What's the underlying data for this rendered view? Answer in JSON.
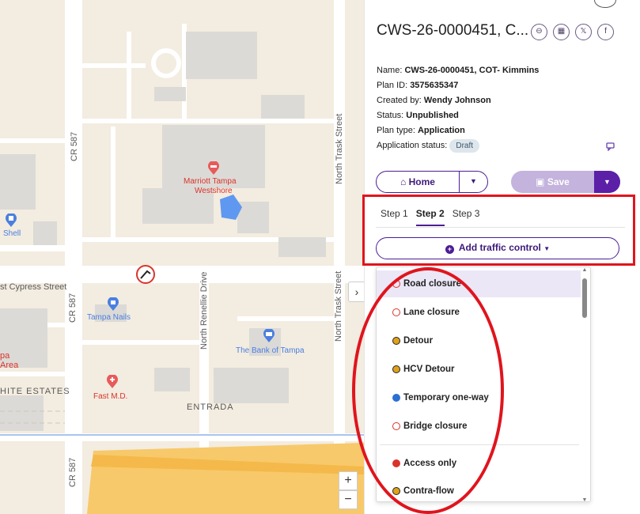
{
  "map": {
    "streets": {
      "cr587_upper": "CR 587",
      "cr587_mid": "CR 587",
      "cr587_lower": "CR 587",
      "north_trask_upper": "North Trask Street",
      "north_trask_lower": "North Trask Street",
      "north_renellie": "North Renellie Drive",
      "cypress": "st Cypress Street",
      "entrada": "ENTRADA",
      "estates": "HITE ESTATES",
      "area_a": "pa",
      "area_b": "Area"
    },
    "pois": {
      "marriott_line1": "Marriott Tampa",
      "marriott_line2": "Westshore",
      "shell": "Shell",
      "tampa_nails": "Tampa Nails",
      "bank": "The Bank of Tampa",
      "fast_md": "Fast M.D."
    },
    "zoom_in": "+",
    "zoom_out": "−",
    "collapse": "›",
    "colors": {
      "road": "#ffffff",
      "block": "#f3ece0",
      "building": "#dcdad6",
      "highway": "#f7c96a",
      "water": "#5f98f0",
      "poi_red": "#e85a5a",
      "poi_blue": "#4a7fe0"
    }
  },
  "panel": {
    "title": "CWS-26-0000451, C...",
    "share": {
      "link": "⊖",
      "qr": "▦",
      "x": "𝕏",
      "facebook": "f"
    },
    "meta": {
      "name_label": "Name: ",
      "name_value": "CWS-26-0000451, COT- Kimmins",
      "plan_id_label": "Plan ID: ",
      "plan_id_value": "3575635347",
      "created_label": "Created by: ",
      "created_value": "Wendy Johnson",
      "status_label": "Status: ",
      "status_value": "Unpublished",
      "plan_type_label": "Plan type: ",
      "plan_type_value": "Application",
      "app_status_label": "Application status: ",
      "app_status_value": "Draft"
    },
    "home_button": "Home",
    "save_button": "Save",
    "tabs": [
      "Step 1",
      "Step 2",
      "Step 3"
    ],
    "active_tab": "Step 2",
    "add_traffic_control": "Add traffic control",
    "dropdown": [
      {
        "label": "Road closure",
        "color": "#d9342b"
      },
      {
        "label": "Lane closure",
        "color": "#d9342b"
      },
      {
        "label": "Detour",
        "color": "#e0a21b"
      },
      {
        "label": "HCV Detour",
        "color": "#e0a21b"
      },
      {
        "label": "Temporary one-way",
        "color": "#2c6fd1"
      },
      {
        "label": "Bridge closure",
        "color": "#d9342b"
      },
      {
        "label": "Access only",
        "color": "#d9342b"
      },
      {
        "label": "Contra-flow",
        "color": "#e0a21b"
      }
    ],
    "annotation_color": "#e0141d"
  }
}
